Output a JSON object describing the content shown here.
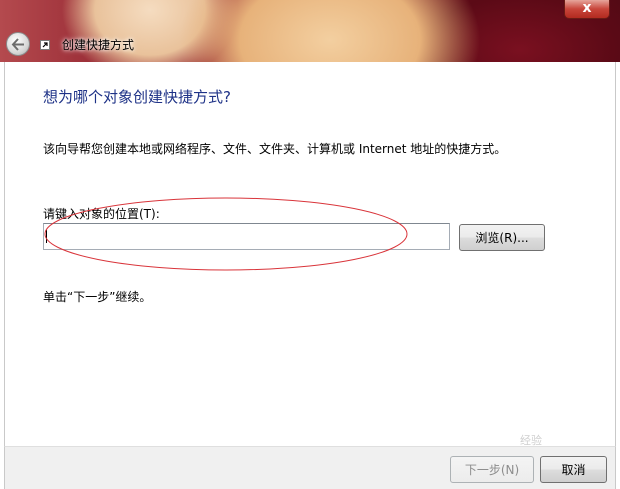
{
  "window": {
    "title": "创建快捷方式",
    "close_label": "x"
  },
  "page": {
    "heading": "想为哪个对象创建快捷方式?",
    "description": "该向导帮您创建本地或网络程序、文件、文件夹、计算机或 Internet 地址的快捷方式。",
    "input_label": "请键入对象的位置(T):",
    "input_value": "",
    "browse_label": "浏览(R)...",
    "hint": "单击“下一步”继续。"
  },
  "footer": {
    "next_label": "下一步(N)",
    "cancel_label": "取消"
  },
  "watermark": "经验",
  "colors": {
    "heading": "#1e3287",
    "annotation": "#d9343a"
  }
}
